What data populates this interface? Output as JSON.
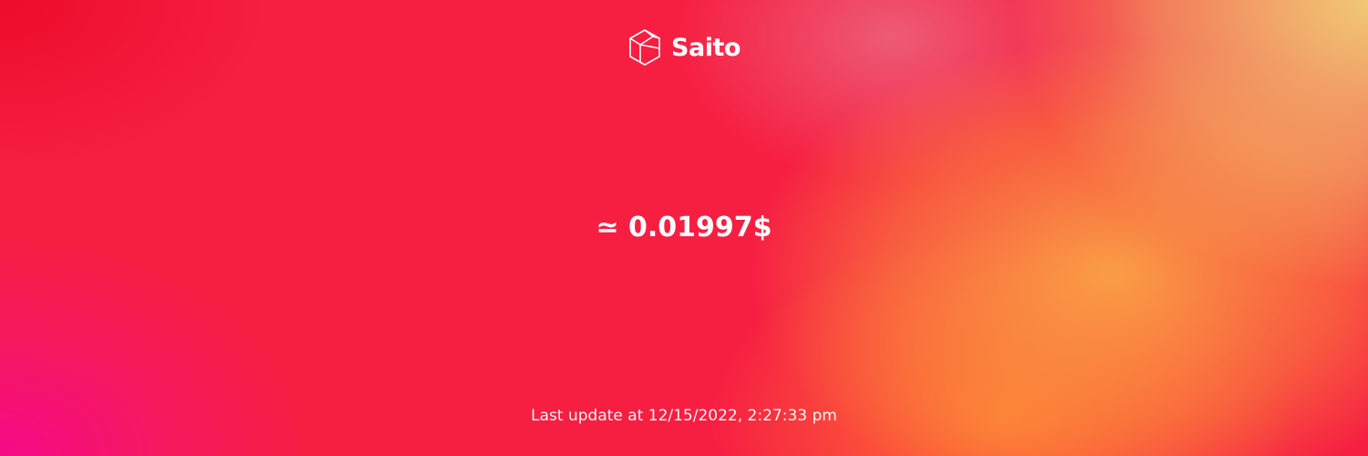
{
  "brand": {
    "name": "Saito",
    "logo_icon": "cube-logo-icon"
  },
  "price": {
    "text": "≃ 0.01997$"
  },
  "status": {
    "last_update": "Last update at 12/15/2022, 2:27:33 pm"
  },
  "colors": {
    "base": "#f61f42",
    "orange": "#ff8a3d",
    "yellow": "#f0cf72",
    "magenta": "#f50a8c",
    "text": "#ffffff"
  }
}
